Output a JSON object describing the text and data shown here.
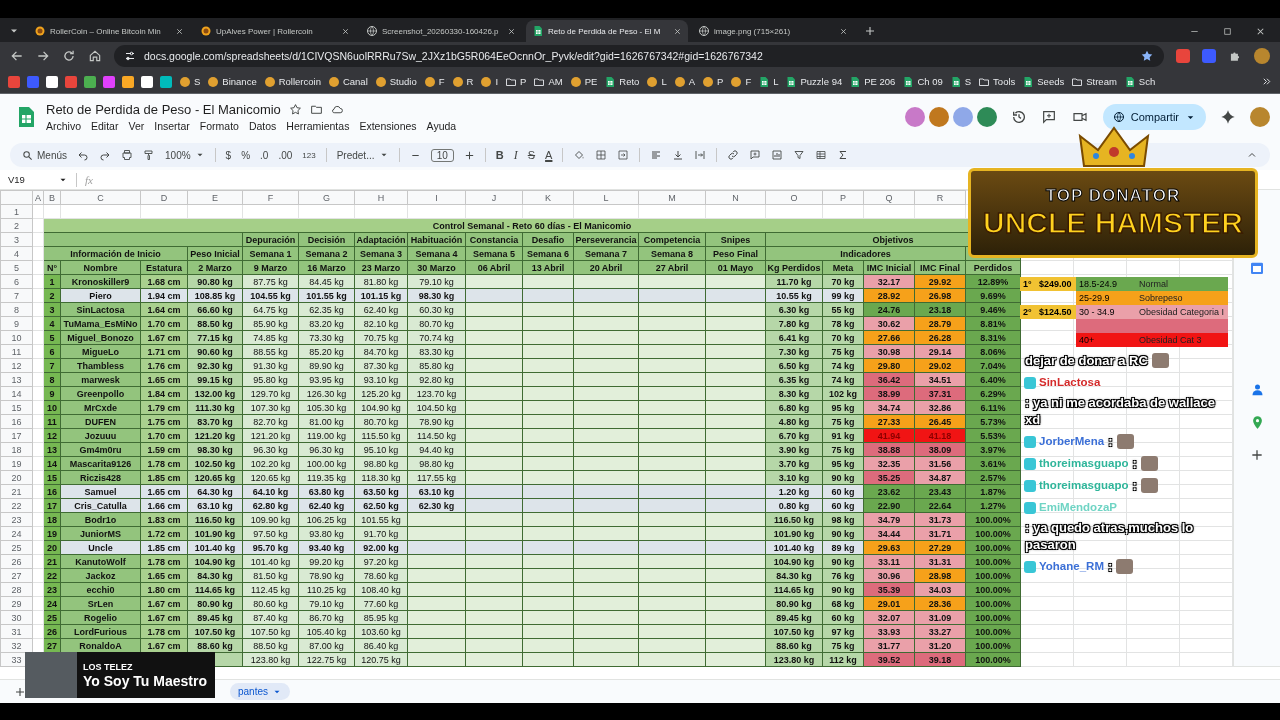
{
  "browser": {
    "tabs": [
      {
        "title": "RollerCoin – Online Bitcoin Min",
        "kind": "coin",
        "selected": false
      },
      {
        "title": "UpAlves Power | Rollercoin",
        "kind": "coin",
        "selected": false
      },
      {
        "title": "Screenshot_20260330-160426.p",
        "kind": "web",
        "selected": false
      },
      {
        "title": "Reto de Perdida de Peso - El M",
        "kind": "sheets",
        "selected": true
      },
      {
        "title": "image.png (715×261)",
        "kind": "web",
        "selected": false
      }
    ],
    "url": "docs.google.com/spreadsheets/d/1CIVQSN6uolRRRu7Sw_2JXz1bG5R064EeOcnnOr_Pyvk/edit?gid=1626767342#gid=1626767342",
    "bookmarks": [
      {
        "label": "S",
        "kind": "site"
      },
      {
        "label": "Binance",
        "kind": "site"
      },
      {
        "label": "Rollercoin",
        "kind": "site"
      },
      {
        "label": "Canal",
        "kind": "site"
      },
      {
        "label": "Studio",
        "kind": "site"
      },
      {
        "label": "F",
        "kind": "site"
      },
      {
        "label": "R",
        "kind": "site"
      },
      {
        "label": "I",
        "kind": "site"
      },
      {
        "label": "P",
        "kind": "folder"
      },
      {
        "label": "AM",
        "kind": "folder"
      },
      {
        "label": "PE",
        "kind": "site"
      },
      {
        "label": "Reto",
        "kind": "sheet"
      },
      {
        "label": "L",
        "kind": "site"
      },
      {
        "label": "A",
        "kind": "site"
      },
      {
        "label": "P",
        "kind": "site"
      },
      {
        "label": "F",
        "kind": "site"
      },
      {
        "label": "L",
        "kind": "sheet"
      },
      {
        "label": "Puzzle 94",
        "kind": "sheet"
      },
      {
        "label": "PE 206",
        "kind": "sheet"
      },
      {
        "label": "Ch 09",
        "kind": "sheet"
      },
      {
        "label": "S",
        "kind": "sheet"
      },
      {
        "label": "Tools",
        "kind": "folder"
      },
      {
        "label": "Seeds",
        "kind": "sheet"
      },
      {
        "label": "Stream",
        "kind": "folder"
      },
      {
        "label": "Sch",
        "kind": "sheet"
      }
    ]
  },
  "document": {
    "title": "Reto de Perdida de Peso - El Manicomio",
    "menus": [
      "Archivo",
      "Editar",
      "Ver",
      "Insertar",
      "Formato",
      "Datos",
      "Herramientas",
      "Extensiones",
      "Ayuda"
    ],
    "share": "Compartir"
  },
  "toolbar": {
    "search": "Menús",
    "zoom": "100%",
    "currency": "$",
    "percent": "%",
    "decimals_less": ".0",
    "decimals_more": ".00",
    "number_format": "123",
    "font": "Predet...",
    "font_size": "10",
    "bold": "B",
    "italic": "I",
    "strikethrough": "S",
    "text_color": "A"
  },
  "formula_bar": {
    "cell": "V19",
    "fx": "fx"
  },
  "column_letters": [
    "A",
    "B",
    "C",
    "D",
    "E",
    "F",
    "G",
    "H",
    "I",
    "J",
    "K",
    "L",
    "M",
    "N",
    "O",
    "P",
    "Q",
    "R"
  ],
  "row_numbers": [
    "1",
    "2",
    "3",
    "4",
    "5",
    "6",
    "7",
    "8",
    "9",
    "10",
    "11",
    "12",
    "13",
    "14",
    "15",
    "16",
    "17",
    "18",
    "19",
    "20",
    "21",
    "22",
    "23",
    "24",
    "25",
    "26",
    "27",
    "28",
    "29",
    "30",
    "31",
    "32",
    "33"
  ],
  "sheet": {
    "title": "Control Semanal - Reto 60 días - El Manicomio",
    "stages": [
      "Depuración",
      "Decisión",
      "Adaptación",
      "Habituación",
      "Constancia",
      "Desafio",
      "Perseverancia",
      "Competencia",
      "Snipes"
    ],
    "objectives": "Objetivos",
    "info": "Información de Inicio",
    "initial": "Peso Inicial",
    "weeks": [
      "Semana 1",
      "Semana 2",
      "Semana 3",
      "Semana 4",
      "Semana 5",
      "Semana 6",
      "Semana 7",
      "Semana 8"
    ],
    "final": "Peso Final",
    "indicators": "Indicadores",
    "column_titles": [
      "N°",
      "Nombre",
      "Estatura",
      "2 Marzo",
      "9 Marzo",
      "16 Marzo",
      "23 Marzo",
      "30 Marzo",
      "06 Abril",
      "13 Abril",
      "20 Abril",
      "27 Abril",
      "01 Mayo",
      "Kg Perdidos",
      "Meta",
      "IMC Inicial",
      "IMC Final",
      "Perdidos"
    ]
  },
  "rows": [
    {
      "n": "1",
      "name": "Kronoskiller9",
      "height": "1.68 cm",
      "initial": "90.80 kg",
      "weeks": [
        "87.75 kg",
        "84.45 kg",
        "81.80 kg",
        "79.10 kg"
      ],
      "lost": "11.70 kg",
      "goal": "70 kg",
      "bmi_start": {
        "value": "32.17",
        "color": "#eaa0a9"
      },
      "bmi_end": {
        "value": "29.92",
        "color": "#f6a11a"
      },
      "percent": "12.89%",
      "highlighted": false
    },
    {
      "n": "2",
      "name": "Piero",
      "height": "1.94 cm",
      "initial": "108.85 kg",
      "weeks": [
        "104.55 kg",
        "101.55 kg",
        "101.15 kg",
        "98.30 kg"
      ],
      "lost": "10.55 kg",
      "goal": "99 kg",
      "bmi_start": {
        "value": "28.92",
        "color": "#f6a11a"
      },
      "bmi_end": {
        "value": "26.98",
        "color": "#f6a11a"
      },
      "percent": "9.69%",
      "highlighted": true
    },
    {
      "n": "3",
      "name": "SinLactosa",
      "height": "1.64 cm",
      "initial": "66.60 kg",
      "weeks": [
        "64.75 kg",
        "62.35 kg",
        "62.40 kg",
        "60.30 kg"
      ],
      "lost": "6.30 kg",
      "goal": "55 kg",
      "bmi_start": {
        "value": "24.76",
        "color": "#6aa84f"
      },
      "bmi_end": {
        "value": "23.18",
        "color": "#6aa84f"
      },
      "percent": "9.46%",
      "highlighted": false
    },
    {
      "n": "4",
      "name": "TuMama_EsMiNo",
      "height": "1.70 cm",
      "initial": "88.50 kg",
      "weeks": [
        "85.90 kg",
        "83.20 kg",
        "82.10 kg",
        "80.70 kg"
      ],
      "lost": "7.80 kg",
      "goal": "78 kg",
      "bmi_start": {
        "value": "30.62",
        "color": "#eaa0a9"
      },
      "bmi_end": {
        "value": "28.79",
        "color": "#f6a11a"
      },
      "percent": "8.81%",
      "highlighted": false
    },
    {
      "n": "5",
      "name": "Miguel_Bonozo",
      "height": "1.67 cm",
      "initial": "77.15 kg",
      "weeks": [
        "74.85 kg",
        "73.30 kg",
        "70.75 kg",
        "70.74 kg"
      ],
      "lost": "6.41 kg",
      "goal": "70 kg",
      "bmi_start": {
        "value": "27.66",
        "color": "#f6a11a"
      },
      "bmi_end": {
        "value": "26.28",
        "color": "#f6a11a"
      },
      "percent": "8.31%",
      "highlighted": false
    },
    {
      "n": "6",
      "name": "MigueLo",
      "height": "1.71 cm",
      "initial": "90.60 kg",
      "weeks": [
        "88.55 kg",
        "85.20 kg",
        "84.70 kg",
        "83.30 kg"
      ],
      "lost": "7.30 kg",
      "goal": "75 kg",
      "bmi_start": {
        "value": "30.98",
        "color": "#eaa0a9"
      },
      "bmi_end": {
        "value": "29.14",
        "color": "#eaa0a9"
      },
      "percent": "8.06%",
      "highlighted": false
    },
    {
      "n": "7",
      "name": "Thambless",
      "height": "1.76 cm",
      "initial": "92.30 kg",
      "weeks": [
        "91.30 kg",
        "89.90 kg",
        "87.30 kg",
        "85.80 kg"
      ],
      "lost": "6.50 kg",
      "goal": "74 kg",
      "bmi_start": {
        "value": "29.80",
        "color": "#f6a11a"
      },
      "bmi_end": {
        "value": "29.02",
        "color": "#f6a11a"
      },
      "percent": "7.04%",
      "highlighted": false
    },
    {
      "n": "8",
      "name": "marwesk",
      "height": "1.65 cm",
      "initial": "99.15 kg",
      "weeks": [
        "95.80 kg",
        "93.95 kg",
        "93.10 kg",
        "92.80 kg"
      ],
      "lost": "6.35 kg",
      "goal": "74 kg",
      "bmi_start": {
        "value": "36.42",
        "color": "#dd6b7c"
      },
      "bmi_end": {
        "value": "34.51",
        "color": "#eaa0a9"
      },
      "percent": "6.40%",
      "highlighted": false
    },
    {
      "n": "9",
      "name": "Greenpollo",
      "height": "1.84 cm",
      "initial": "132.00 kg",
      "weeks": [
        "129.70 kg",
        "126.30 kg",
        "125.20 kg",
        "123.70 kg"
      ],
      "lost": "8.30 kg",
      "goal": "102 kg",
      "bmi_start": {
        "value": "38.99",
        "color": "#dd6b7c"
      },
      "bmi_end": {
        "value": "37.31",
        "color": "#dd6b7c"
      },
      "percent": "6.29%",
      "highlighted": false
    },
    {
      "n": "10",
      "name": "MrCxde",
      "height": "1.79 cm",
      "initial": "111.30 kg",
      "weeks": [
        "107.30 kg",
        "105.30 kg",
        "104.90 kg",
        "104.50 kg"
      ],
      "lost": "6.80 kg",
      "goal": "95 kg",
      "bmi_start": {
        "value": "34.74",
        "color": "#eaa0a9"
      },
      "bmi_end": {
        "value": "32.86",
        "color": "#eaa0a9"
      },
      "percent": "6.11%",
      "highlighted": false
    },
    {
      "n": "11",
      "name": "DUFEN",
      "height": "1.75 cm",
      "initial": "83.70 kg",
      "weeks": [
        "82.70 kg",
        "81.00 kg",
        "80.70 kg",
        "78.90 kg"
      ],
      "lost": "4.80 kg",
      "goal": "75 kg",
      "bmi_start": {
        "value": "27.33",
        "color": "#f6a11a"
      },
      "bmi_end": {
        "value": "26.45",
        "color": "#f6a11a"
      },
      "percent": "5.73%",
      "highlighted": false
    },
    {
      "n": "12",
      "name": "Jozuuu",
      "height": "1.70 cm",
      "initial": "121.20 kg",
      "weeks": [
        "121.20 kg",
        "119.00 kg",
        "115.50 kg",
        "114.50 kg"
      ],
      "lost": "6.70 kg",
      "goal": "91 kg",
      "bmi_start": {
        "value": "41.94",
        "color": "#f11414"
      },
      "bmi_end": {
        "value": "41.18",
        "color": "#f11414"
      },
      "percent": "5.53%",
      "highlighted": false
    },
    {
      "n": "13",
      "name": "Gm4m0ru",
      "height": "1.59 cm",
      "initial": "98.30 kg",
      "weeks": [
        "96.30 kg",
        "96.30 kg",
        "95.10 kg",
        "94.40 kg"
      ],
      "lost": "3.90 kg",
      "goal": "75 kg",
      "bmi_start": {
        "value": "38.88",
        "color": "#dd6b7c"
      },
      "bmi_end": {
        "value": "38.09",
        "color": "#dd6b7c"
      },
      "percent": "3.97%",
      "highlighted": false
    },
    {
      "n": "14",
      "name": "Mascarita9126",
      "height": "1.78 cm",
      "initial": "102.50 kg",
      "weeks": [
        "102.20 kg",
        "100.00 kg",
        "98.80 kg",
        "98.80 kg"
      ],
      "lost": "3.70 kg",
      "goal": "95 kg",
      "bmi_start": {
        "value": "32.35",
        "color": "#eaa0a9"
      },
      "bmi_end": {
        "value": "31.56",
        "color": "#eaa0a9"
      },
      "percent": "3.61%",
      "highlighted": false
    },
    {
      "n": "15",
      "name": "Riczis428",
      "height": "1.85 cm",
      "initial": "120.65 kg",
      "weeks": [
        "120.65 kg",
        "119.35 kg",
        "118.30 kg",
        "117.55 kg"
      ],
      "lost": "3.10 kg",
      "goal": "90 kg",
      "bmi_start": {
        "value": "35.25",
        "color": "#dd6b7c"
      },
      "bmi_end": {
        "value": "34.87",
        "color": "#eaa0a9"
      },
      "percent": "2.57%",
      "highlighted": false
    },
    {
      "n": "16",
      "name": "Samuel",
      "height": "1.65 cm",
      "initial": "64.30 kg",
      "weeks": [
        "64.10 kg",
        "63.80 kg",
        "63.50 kg",
        "63.10 kg"
      ],
      "lost": "1.20 kg",
      "goal": "60 kg",
      "bmi_start": {
        "value": "23.62",
        "color": "#6aa84f"
      },
      "bmi_end": {
        "value": "23.43",
        "color": "#6aa84f"
      },
      "percent": "1.87%",
      "highlighted": true
    },
    {
      "n": "17",
      "name": "Cris_Catulla",
      "height": "1.66 cm",
      "initial": "63.10 kg",
      "weeks": [
        "62.80 kg",
        "62.40 kg",
        "62.50 kg",
        "62.30 kg"
      ],
      "lost": "0.80 kg",
      "goal": "60 kg",
      "bmi_start": {
        "value": "22.90",
        "color": "#6aa84f"
      },
      "bmi_end": {
        "value": "22.64",
        "color": "#6aa84f"
      },
      "percent": "1.27%",
      "highlighted": true
    },
    {
      "n": "18",
      "name": "Bodr1o",
      "height": "1.83 cm",
      "initial": "116.50 kg",
      "weeks": [
        "109.90 kg",
        "106.25 kg",
        "101.55 kg"
      ],
      "lost": "116.50 kg",
      "goal": "98 kg",
      "bmi_start": {
        "value": "34.79",
        "color": "#eaa0a9"
      },
      "bmi_end": {
        "value": "31.73",
        "color": "#eaa0a9"
      },
      "percent": "100.00%",
      "highlighted": false
    },
    {
      "n": "19",
      "name": "JuniorMS",
      "height": "1.72 cm",
      "initial": "101.90 kg",
      "weeks": [
        "97.50 kg",
        "93.80 kg",
        "91.70 kg"
      ],
      "lost": "101.90 kg",
      "goal": "90 kg",
      "bmi_start": {
        "value": "34.44",
        "color": "#eaa0a9"
      },
      "bmi_end": {
        "value": "31.71",
        "color": "#eaa0a9"
      },
      "percent": "100.00%",
      "highlighted": false
    },
    {
      "n": "20",
      "name": "Uncle",
      "height": "1.85 cm",
      "initial": "101.40 kg",
      "weeks": [
        "95.70 kg",
        "93.40 kg",
        "92.00 kg"
      ],
      "lost": "101.40 kg",
      "goal": "89 kg",
      "bmi_start": {
        "value": "29.63",
        "color": "#f6a11a"
      },
      "bmi_end": {
        "value": "27.29",
        "color": "#f6a11a"
      },
      "percent": "100.00%",
      "highlighted": true
    },
    {
      "n": "21",
      "name": "KanutoWolf",
      "height": "1.78 cm",
      "initial": "104.90 kg",
      "weeks": [
        "101.40 kg",
        "99.20 kg",
        "97.20 kg"
      ],
      "lost": "104.90 kg",
      "goal": "90 kg",
      "bmi_start": {
        "value": "33.11",
        "color": "#eaa0a9"
      },
      "bmi_end": {
        "value": "31.31",
        "color": "#eaa0a9"
      },
      "percent": "100.00%",
      "highlighted": false
    },
    {
      "n": "22",
      "name": "Jackoz",
      "height": "1.65 cm",
      "initial": "84.30 kg",
      "weeks": [
        "81.50 kg",
        "78.90 kg",
        "78.60 kg"
      ],
      "lost": "84.30 kg",
      "goal": "76 kg",
      "bmi_start": {
        "value": "30.96",
        "color": "#eaa0a9"
      },
      "bmi_end": {
        "value": "28.98",
        "color": "#f6a11a"
      },
      "percent": "100.00%",
      "highlighted": false
    },
    {
      "n": "23",
      "name": "ecchi0",
      "height": "1.80 cm",
      "initial": "114.65 kg",
      "weeks": [
        "112.45 kg",
        "110.25 kg",
        "108.40 kg"
      ],
      "lost": "114.65 kg",
      "goal": "90 kg",
      "bmi_start": {
        "value": "35.39",
        "color": "#dd6b7c"
      },
      "bmi_end": {
        "value": "34.03",
        "color": "#eaa0a9"
      },
      "percent": "100.00%",
      "highlighted": false
    },
    {
      "n": "24",
      "name": "SrLen",
      "height": "1.67 cm",
      "initial": "80.90 kg",
      "weeks": [
        "80.60 kg",
        "79.10 kg",
        "77.60 kg"
      ],
      "lost": "80.90 kg",
      "goal": "68 kg",
      "bmi_start": {
        "value": "29.01",
        "color": "#f6a11a"
      },
      "bmi_end": {
        "value": "28.36",
        "color": "#f6a11a"
      },
      "percent": "100.00%",
      "highlighted": false
    },
    {
      "n": "25",
      "name": "Rogelio",
      "height": "1.67 cm",
      "initial": "89.45 kg",
      "weeks": [
        "87.40 kg",
        "86.70 kg",
        "85.95 kg"
      ],
      "lost": "89.45 kg",
      "goal": "60 kg",
      "bmi_start": {
        "value": "32.07",
        "color": "#eaa0a9"
      },
      "bmi_end": {
        "value": "31.09",
        "color": "#eaa0a9"
      },
      "percent": "100.00%",
      "highlighted": false
    },
    {
      "n": "26",
      "name": "LordFurious",
      "height": "1.78 cm",
      "initial": "107.50 kg",
      "weeks": [
        "107.50 kg",
        "105.40 kg",
        "103.60 kg"
      ],
      "lost": "107.50 kg",
      "goal": "97 kg",
      "bmi_start": {
        "value": "33.93",
        "color": "#eaa0a9"
      },
      "bmi_end": {
        "value": "33.27",
        "color": "#eaa0a9"
      },
      "percent": "100.00%",
      "highlighted": false
    },
    {
      "n": "27",
      "name": "RonaldoA",
      "height": "1.67 cm",
      "initial": "88.60 kg",
      "weeks": [
        "88.50 kg",
        "87.00 kg",
        "86.40 kg"
      ],
      "lost": "88.60 kg",
      "goal": "75 kg",
      "bmi_start": {
        "value": "31.77",
        "color": "#eaa0a9"
      },
      "bmi_end": {
        "value": "31.20",
        "color": "#eaa0a9"
      },
      "percent": "100.00%",
      "highlighted": false
    },
    {
      "weeks": [
        "123.80 kg",
        "122.75 kg",
        "120.75 kg"
      ],
      "lost": "123.80 kg",
      "goal": "112 kg",
      "bmi_start": {
        "value": "39.52",
        "color": "#dd6b7c"
      },
      "bmi_end": {
        "value": "39.18",
        "color": "#dd6b7c"
      },
      "percent": "100.00%",
      "highlighted": false
    }
  ],
  "legend": [
    {
      "place": "1°",
      "prize": "$249.00",
      "range": "18.5-24.9",
      "label": "Normal",
      "color": "#6aa84f"
    },
    {
      "range": "25-29.9",
      "label": "Sobrepeso",
      "color": "#f6a11a"
    },
    {
      "place": "2°",
      "prize": "$124.50",
      "range": "30 - 34.9",
      "label": "Obesidad Categoria I",
      "color": "#eaa0a9"
    },
    {
      "color": "#dd6b7c"
    },
    {
      "range": "40+",
      "label": "Obesidad Cat 3",
      "color": "#f11414"
    }
  ],
  "banner": {
    "heading": "TOP DONATOR",
    "name": "UNCLE HAMSTER"
  },
  "chat": [
    {
      "text": "dejar de donar a RC",
      "emote": true
    },
    {
      "user": "SinLactosa",
      "text": ": ya ni me acordaba de wallace xd",
      "color": "#d42a2a",
      "emote": false
    },
    {
      "user": "JorberMena",
      "text": ":",
      "color": "#3b6fd6",
      "emote": true
    },
    {
      "user": "thoreimasguapo",
      "text": ":",
      "color": "#2fb59a",
      "emote": true
    },
    {
      "user": "thoreimasguapo",
      "text": ":",
      "color": "#2fb59a",
      "emote": true
    },
    {
      "user": "EmiMendozaP",
      "text": ": ya quedo atras,muchos lo pasaron",
      "color": "#6fd4c4",
      "emote": false
    },
    {
      "user": "Yohane_RM",
      "text": ":",
      "color": "#3b6fd6",
      "emote": true
    }
  ],
  "stream_card": {
    "channel": "LOS TELEZ",
    "title": "Yo Soy Tu Maestro"
  },
  "sheet_tab": {
    "label": "pantes"
  }
}
